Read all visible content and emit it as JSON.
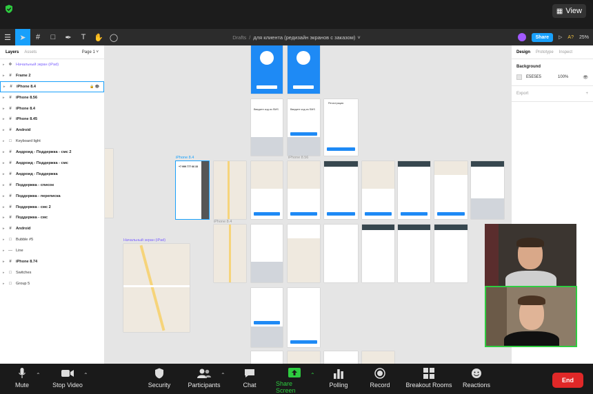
{
  "zoom_top": {
    "view_label": "View"
  },
  "figma": {
    "breadcrumb_folder": "Drafts",
    "breadcrumb_sep": "/",
    "file_name": "для клиента (редизайн экранов с заказом)",
    "share_label": "Share",
    "zoom_level": "25%",
    "collab_badge": "A?"
  },
  "left_panel": {
    "tab_layers": "Layers",
    "tab_assets": "Assets",
    "page_label": "Page 1",
    "layers": [
      {
        "label": "Начальный экран (iPad)",
        "icon": "component-icon",
        "style": "purple"
      },
      {
        "label": "Frame 2",
        "icon": "frame-icon",
        "style": "bold"
      },
      {
        "label": "iPhone 8.4",
        "icon": "frame-icon",
        "style": "bold sel"
      },
      {
        "label": "iPhone 8.56",
        "icon": "frame-icon",
        "style": "bold"
      },
      {
        "label": "iPhone 8.4",
        "icon": "frame-icon",
        "style": "bold"
      },
      {
        "label": "iPhone 8.45",
        "icon": "frame-icon",
        "style": "bold"
      },
      {
        "label": "Android",
        "icon": "frame-icon",
        "style": "bold"
      },
      {
        "label": "Keyboard light",
        "icon": "group-icon",
        "style": ""
      },
      {
        "label": "Андроид - Поддержка - смс 2",
        "icon": "frame-icon",
        "style": "bold"
      },
      {
        "label": "Андроид - Поддержка - смс",
        "icon": "frame-icon",
        "style": "bold"
      },
      {
        "label": "Андроид - Поддержка",
        "icon": "frame-icon",
        "style": "bold"
      },
      {
        "label": "Поддержка - список",
        "icon": "frame-icon",
        "style": "bold"
      },
      {
        "label": "Поддержка - переписка",
        "icon": "frame-icon",
        "style": "bold"
      },
      {
        "label": "Поддержка - смс 2",
        "icon": "frame-icon",
        "style": "bold"
      },
      {
        "label": "Поддержка - смс",
        "icon": "frame-icon",
        "style": "bold"
      },
      {
        "label": "Android",
        "icon": "frame-icon",
        "style": "bold"
      },
      {
        "label": "Bubble #5",
        "icon": "group-icon",
        "style": ""
      },
      {
        "label": "Line",
        "icon": "line-icon",
        "style": ""
      },
      {
        "label": "iPhone 8.74",
        "icon": "frame-icon",
        "style": "bold"
      },
      {
        "label": "Switches",
        "icon": "group-icon",
        "style": ""
      },
      {
        "label": "Group 5",
        "icon": "group-icon",
        "style": ""
      }
    ]
  },
  "canvas": {
    "label_iphone84": "iPhone 8.4",
    "label_iphone856": "iPhone 8.56",
    "label_iphone84b": "iPhone 8.4",
    "label_ipad": "Начальный экран (iPad)",
    "phone_number": "+7 999 777 66 33",
    "registration": "Регистрация",
    "code_title_1": "Введите код из SMS",
    "code_title_2": "Введите код из SMS"
  },
  "right_panel": {
    "tab_design": "Design",
    "tab_prototype": "Prototype",
    "tab_inspect": "Inspect",
    "background_title": "Background",
    "bg_hex": "E5E5E5",
    "bg_opacity": "100%",
    "export_title": "Export",
    "export_add": "+"
  },
  "zoom_bottom": {
    "mute": "Mute",
    "stop_video": "Stop Video",
    "security": "Security",
    "participants": "Participants",
    "chat": "Chat",
    "share_screen": "Share Screen",
    "polling": "Polling",
    "record": "Record",
    "breakout_rooms": "Breakout Rooms",
    "reactions": "Reactions",
    "end": "End"
  },
  "colors": {
    "figma_blue": "#18a0fb",
    "zoom_green": "#2ecc40",
    "end_red": "#e02828",
    "canvas_bg": "#E5E5E5"
  }
}
